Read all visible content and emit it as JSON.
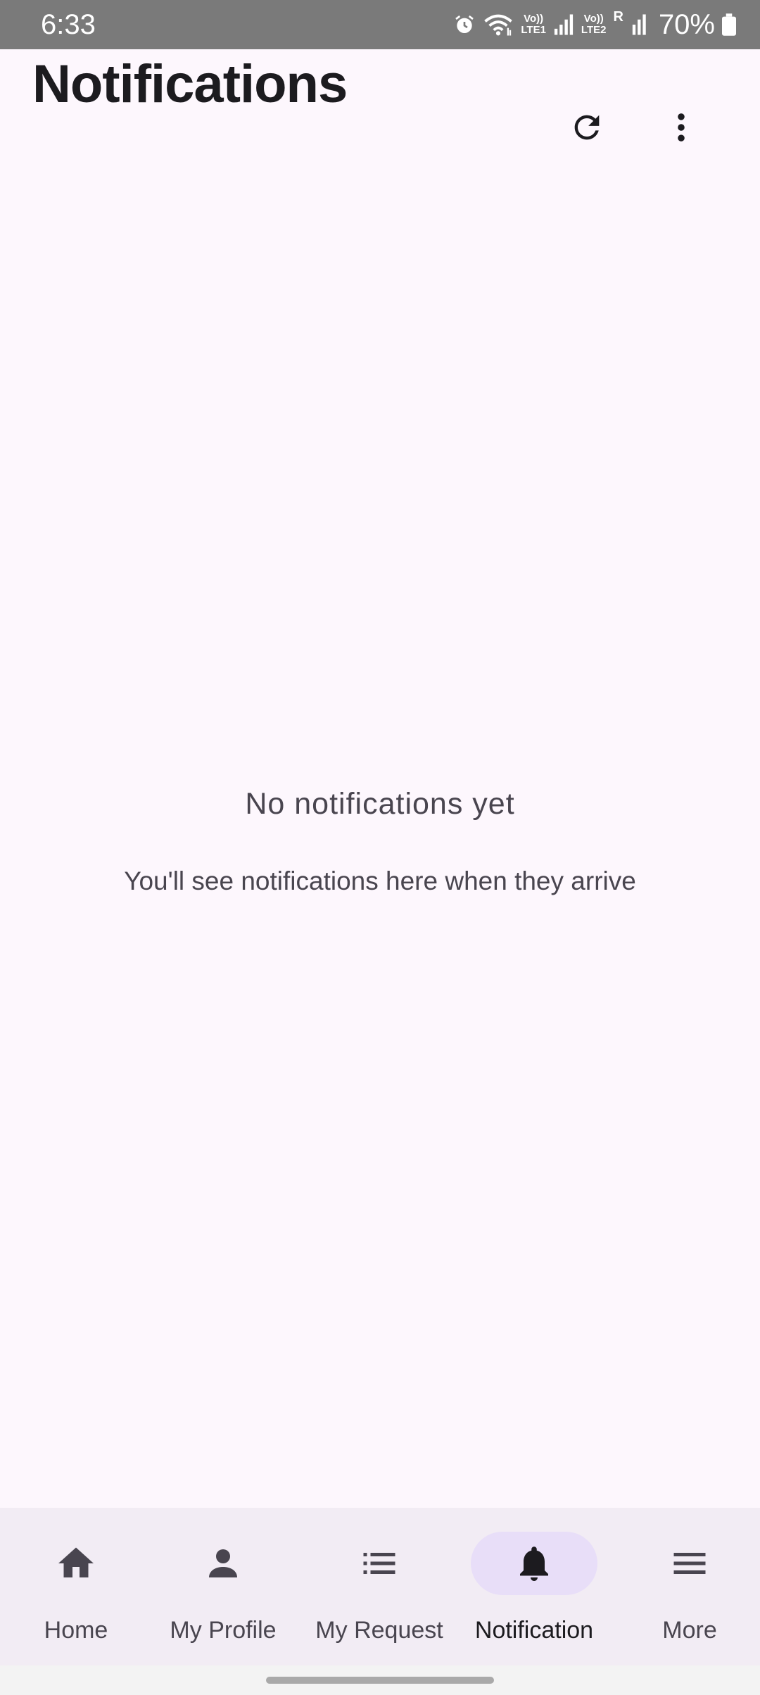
{
  "status_bar": {
    "time": "6:33",
    "network_1": {
      "top": "Vo))",
      "bottom": "LTE1"
    },
    "network_2": {
      "top": "Vo))",
      "bottom": "LTE2"
    },
    "roaming": "R",
    "battery": "70%"
  },
  "header": {
    "title": "Notifications",
    "refresh_icon": "refresh-icon",
    "more_icon": "more-vert-icon"
  },
  "empty_state": {
    "title": "No notifications yet",
    "subtitle": "You'll see notifications here when they arrive"
  },
  "bottom_nav": {
    "items": [
      {
        "label": "Home",
        "icon": "home-icon",
        "active": false
      },
      {
        "label": "My Profile",
        "icon": "person-icon",
        "active": false
      },
      {
        "label": "My Request",
        "icon": "list-icon",
        "active": false
      },
      {
        "label": "Notification",
        "icon": "bell-icon",
        "active": true
      },
      {
        "label": "More",
        "icon": "menu-icon",
        "active": false
      }
    ]
  },
  "colors": {
    "background": "#FDF7FD",
    "nav_background": "#F2ECF4",
    "active_indicator": "#E8DEF8",
    "text_primary": "#1C1B1F",
    "text_secondary": "#49454F"
  }
}
